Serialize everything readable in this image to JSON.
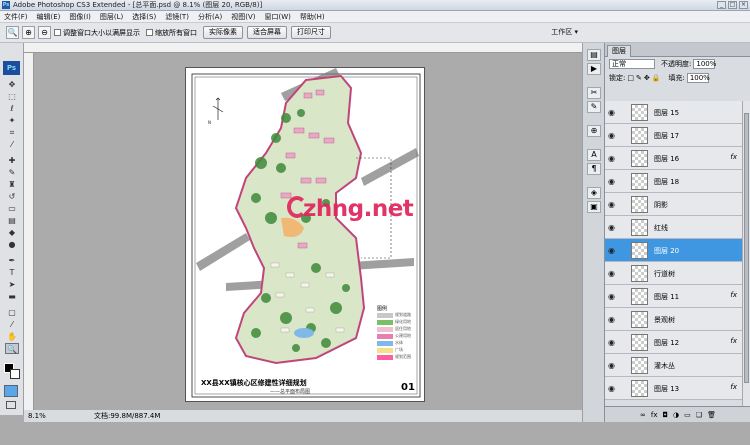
{
  "app": {
    "title": "Adobe Photoshop CS3 Extended - [总平面.psd @ 8.1% (图层 20, RGB/8)]",
    "logo": "Ps",
    "window_buttons": [
      "_",
      "□",
      "×"
    ]
  },
  "menu": [
    "文件(F)",
    "编辑(E)",
    "图像(I)",
    "图层(L)",
    "选择(S)",
    "滤镜(T)",
    "分析(A)",
    "视图(V)",
    "窗口(W)",
    "帮助(H)"
  ],
  "options": {
    "checkbox_resize": "调整窗口大小以满屏显示",
    "checkbox_zoom_all": "缩放所有窗口",
    "btn_actual": "实际像素",
    "btn_fit": "适合屏幕",
    "btn_print": "打印尺寸",
    "workspace": "工作区 ▾"
  },
  "status": {
    "zoom": "8.1%",
    "doc": "文档:99.8M/887.4M"
  },
  "document": {
    "watermark": "zhng.net",
    "plan_title": "XX县XX镇核心区修建性详细规划",
    "plan_subtitle": "——总平面布局图",
    "plan_number": "01",
    "legend_title": "图例",
    "legend": [
      {
        "label": "规划道路",
        "color": "#c8c8c8"
      },
      {
        "label": "绿化用地",
        "color": "#7cbf6a"
      },
      {
        "label": "居住用地",
        "color": "#f0c0d0"
      },
      {
        "label": "公建用地",
        "color": "#e77fb0"
      },
      {
        "label": "水体",
        "color": "#7fb9e8"
      },
      {
        "label": "广场",
        "color": "#f2e08a"
      },
      {
        "label": "规划范围",
        "color": "#ff5f9f"
      }
    ]
  },
  "layers_panel": {
    "tab": "图层",
    "blend_mode": "正常",
    "opacity_label": "不透明度:",
    "opacity_value": "100%",
    "lock_label": "锁定:",
    "fill_label": "填充:",
    "fill_value": "100%",
    "layers": [
      {
        "name": "图层 15",
        "fx": false,
        "active": false
      },
      {
        "name": "图层 17",
        "fx": false,
        "active": false
      },
      {
        "name": "图层 16",
        "fx": true,
        "active": false
      },
      {
        "name": "图层 18",
        "fx": false,
        "active": false
      },
      {
        "name": "阴影",
        "fx": false,
        "active": false
      },
      {
        "name": "红线",
        "fx": false,
        "active": false
      },
      {
        "name": "图层 20",
        "fx": false,
        "active": true
      },
      {
        "name": "行道树",
        "fx": false,
        "active": false
      },
      {
        "name": "图层 11",
        "fx": true,
        "active": false
      },
      {
        "name": "景观树",
        "fx": false,
        "active": false
      },
      {
        "name": "图层 12",
        "fx": true,
        "active": false
      },
      {
        "name": "灌木丛",
        "fx": false,
        "active": false
      },
      {
        "name": "图层 13",
        "fx": true,
        "active": false
      }
    ],
    "bottom_icons": [
      "link-icon",
      "fx-icon",
      "mask-icon",
      "adjustment-icon",
      "group-icon",
      "new-layer-icon",
      "trash-icon"
    ]
  }
}
